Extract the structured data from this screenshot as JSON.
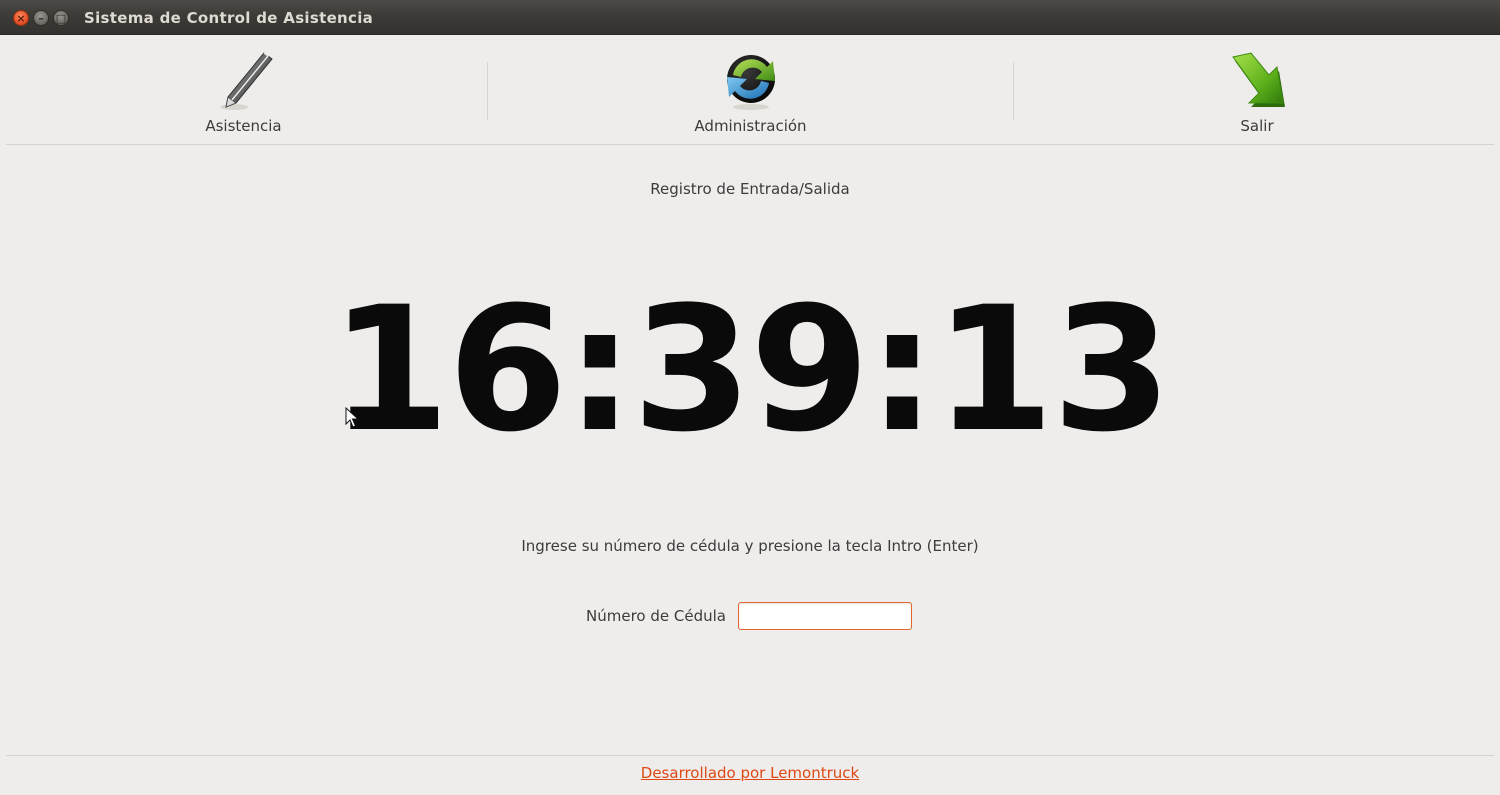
{
  "window": {
    "title": "Sistema de Control de Asistencia",
    "buttons": {
      "close": "×",
      "minimize": "–",
      "maximize": "□"
    }
  },
  "toolbar": {
    "items": [
      {
        "label": "Asistencia",
        "icon": "pen-icon"
      },
      {
        "label": "Administración",
        "icon": "sync-icon"
      },
      {
        "label": "Salir",
        "icon": "exit-arrow-icon"
      }
    ]
  },
  "main": {
    "subtitle": "Registro de Entrada/Salida",
    "clock": "16:39:13",
    "instructions": "Ingrese su número de cédula y presione la tecla Intro (Enter)",
    "cedula_label": "Número de Cédula",
    "cedula_value": ""
  },
  "footer": {
    "link_text": "Desarrollado por Lemontruck"
  },
  "colors": {
    "accent": "#dd4814",
    "input_border": "#e2662e",
    "background": "#efedeb"
  }
}
